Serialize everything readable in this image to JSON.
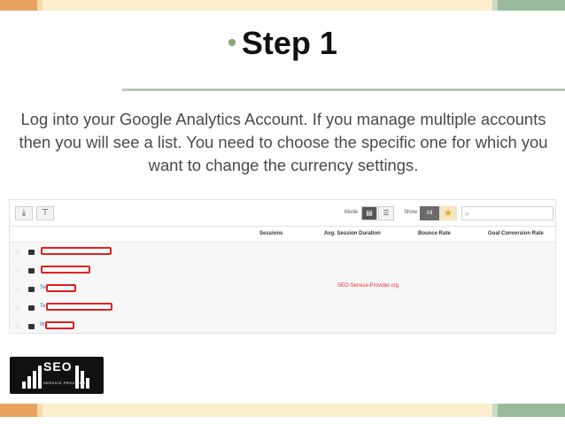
{
  "slide": {
    "bullet": "•",
    "title": "Step 1",
    "body": "Log into your Google Analytics Account. If you manage multiple accounts then you will see a list. You need to choose the specific one for which you want to change the currency settings."
  },
  "colors": {
    "accent_orange": "#e9a35f",
    "accent_green": "#98b99a",
    "redaction_red": "#e02020"
  },
  "ga": {
    "toolbar": {
      "download_icon": "download-icon",
      "upload_icon": "upload-icon",
      "mode_label": "Mode",
      "show_label": "Show",
      "show_all_label": "All",
      "star_icon": "star-icon",
      "search_icon": "search-icon",
      "search_value": ""
    },
    "columns": [
      "Sessions",
      "Avg. Session Duration",
      "Bounce Rate",
      "Goal Conversion Rate"
    ],
    "rows": [
      {
        "visible_text": ""
      },
      {
        "visible_text": ""
      },
      {
        "visible_text": "Se"
      },
      {
        "visible_text": "Te"
      },
      {
        "visible_text": "W"
      }
    ],
    "watermark": "SEO-Service-Provider.org"
  },
  "logo": {
    "word": "SEO",
    "sub": "SERVICE PROVIDER"
  }
}
